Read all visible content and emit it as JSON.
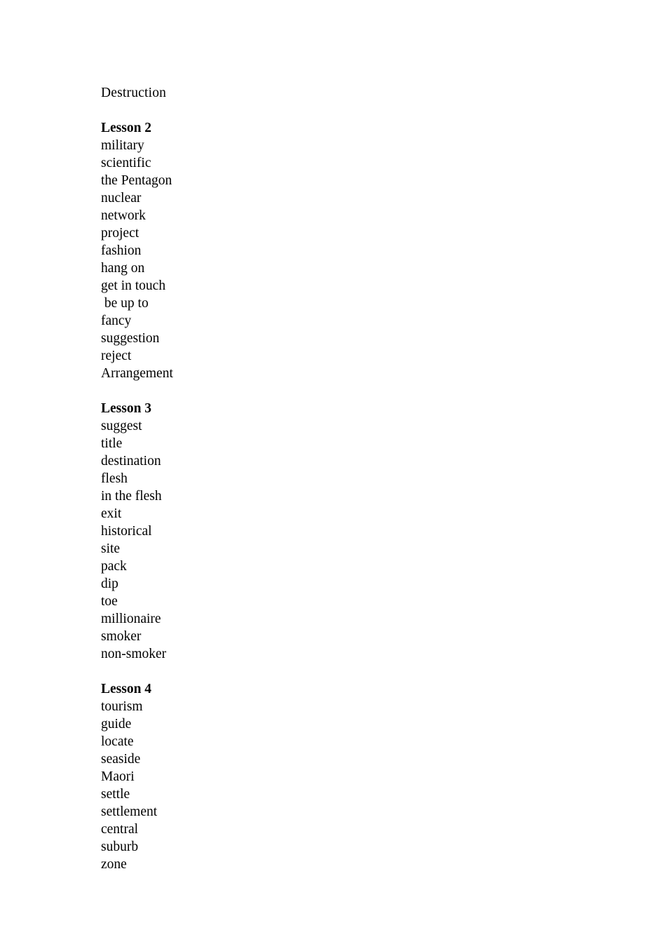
{
  "document": {
    "orphan_line": "Destruction",
    "sections": [
      {
        "heading": "Lesson 2",
        "words": [
          "military",
          "scientific",
          "the Pentagon",
          "nuclear",
          "network",
          "project",
          "fashion",
          "hang on",
          "get in touch",
          " be up to",
          "fancy",
          "suggestion",
          "reject",
          "Arrangement"
        ]
      },
      {
        "heading": "Lesson 3",
        "words": [
          "suggest",
          "title",
          "destination",
          "flesh",
          "in the flesh",
          "exit",
          "historical",
          "site",
          "pack",
          "dip",
          "toe",
          "millionaire",
          "smoker",
          "non-smoker"
        ]
      },
      {
        "heading": "Lesson 4",
        "words": [
          "tourism",
          "guide",
          "locate",
          "seaside",
          "Maori",
          "settle",
          "settlement",
          "central",
          "suburb",
          "zone"
        ]
      }
    ]
  },
  "style": {
    "text_color": "#000000",
    "background_color": "#ffffff"
  }
}
